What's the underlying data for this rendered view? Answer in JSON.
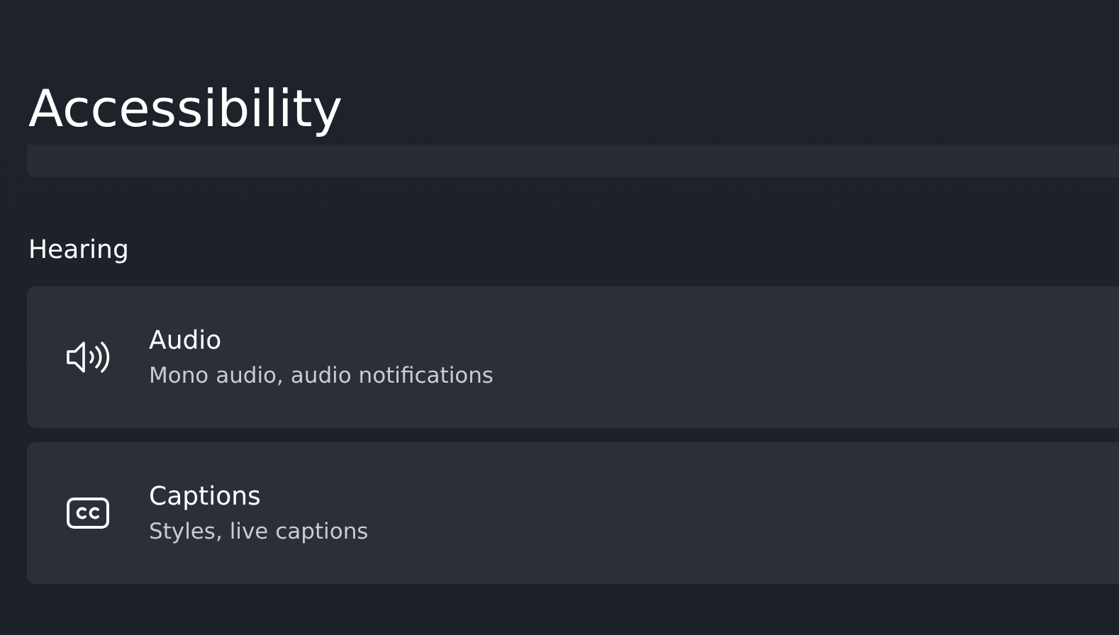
{
  "page": {
    "title": "Accessibility"
  },
  "section": {
    "title": "Hearing"
  },
  "items": [
    {
      "kind": "audio",
      "title": "Audio",
      "subtitle": "Mono audio, audio notifications"
    },
    {
      "kind": "captions",
      "title": "Captions",
      "subtitle": "Styles, live captions"
    }
  ]
}
